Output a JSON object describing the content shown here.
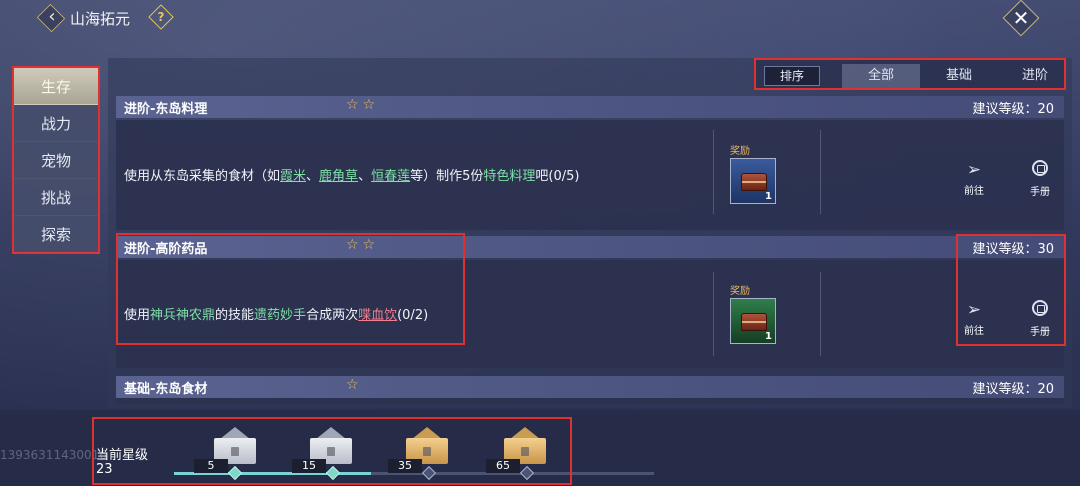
{
  "header": {
    "title": "山海拓元",
    "back_icon": "chevron-left-icon",
    "help_icon": "help-icon",
    "help_glyph": "?",
    "close_icon": "close-icon",
    "close_glyph": "✕"
  },
  "sidebar": {
    "items": [
      {
        "label": "生存",
        "active": true
      },
      {
        "label": "战力",
        "active": false
      },
      {
        "label": "宠物",
        "active": false
      },
      {
        "label": "挑战",
        "active": false
      },
      {
        "label": "探索",
        "active": false
      }
    ]
  },
  "filters": {
    "sort_label": "排序",
    "tabs": [
      {
        "label": "全部",
        "active": true
      },
      {
        "label": "基础",
        "active": false
      },
      {
        "label": "进阶",
        "active": false
      }
    ]
  },
  "tasks": [
    {
      "title": "进阶-东岛料理",
      "stars": "☆☆",
      "level": "建议等级：20",
      "desc_parts": [
        "使用从东岛采集的食材（如",
        "霞米",
        "、",
        "鹿角草",
        "、",
        "恒春莲",
        "等）制作5份",
        "特色料理",
        "吧(0/5)"
      ],
      "reward_label": "奖励",
      "reward_count": "1",
      "goto_label": "前往",
      "manual_label": "手册"
    },
    {
      "title": "进阶-高阶药品",
      "stars": "☆☆",
      "level": "建议等级：30",
      "desc_parts": [
        "使用",
        "神兵神农鼎",
        "的技能",
        "遗药妙手",
        "合成两次",
        "喋血饮",
        "(0/2)"
      ],
      "reward_label": "奖励",
      "reward_count": "1",
      "goto_label": "前往",
      "manual_label": "手册"
    },
    {
      "title": "基础-东岛食材",
      "stars": "☆",
      "level": "建议等级：20"
    }
  ],
  "star_progress": {
    "label": "当前星级",
    "value": "23",
    "watermark": "13936311430016",
    "tiers": [
      {
        "num": "5",
        "style": "silver",
        "reached": true
      },
      {
        "num": "15",
        "style": "silver",
        "reached": true
      },
      {
        "num": "35",
        "style": "gold",
        "reached": false
      },
      {
        "num": "65",
        "style": "gold",
        "reached": false
      }
    ]
  },
  "colors": {
    "accent_green": "#7fe0a6",
    "accent_red": "#f07f8e",
    "star_gold": "#f0c040",
    "highlight_box": "#e03030"
  }
}
